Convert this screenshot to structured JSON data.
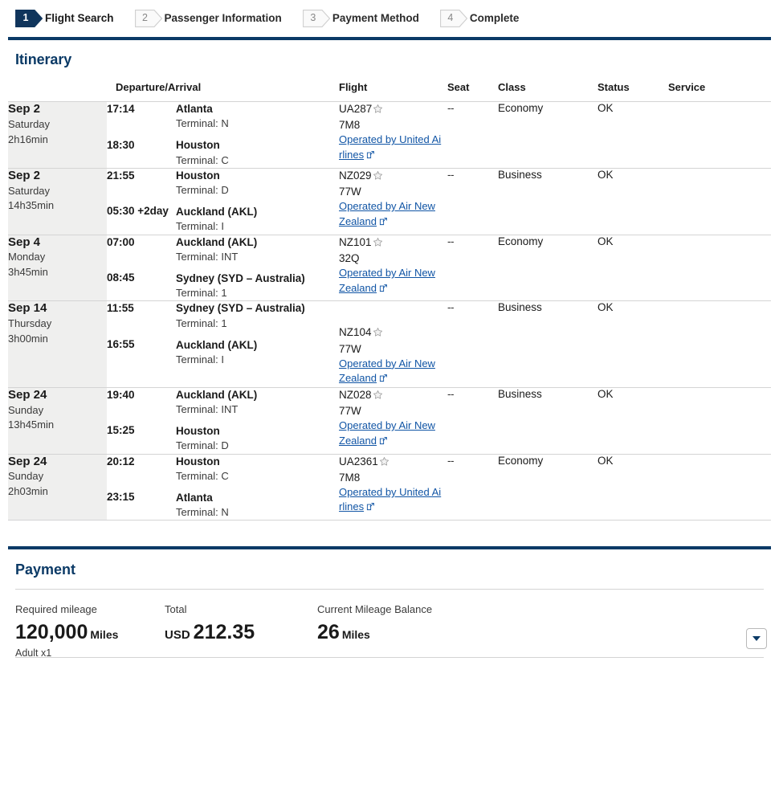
{
  "stepper": {
    "steps": [
      {
        "num": "1",
        "label": "Flight Search",
        "state": "active"
      },
      {
        "num": "2",
        "label": "Passenger Information",
        "state": "inactive"
      },
      {
        "num": "3",
        "label": "Payment Method",
        "state": "inactive"
      },
      {
        "num": "4",
        "label": "Complete",
        "state": "inactive"
      }
    ]
  },
  "itinerary": {
    "title": "Itinerary",
    "columns": {
      "date": "",
      "departure_arrival": "Departure/Arrival",
      "flight": "Flight",
      "seat": "Seat",
      "class": "Class",
      "status": "Status",
      "service": "Service"
    },
    "rows": [
      {
        "date": "Sep 2",
        "weekday": "Saturday",
        "duration": "2h16min",
        "dep_time": "17:14",
        "dep_place": "Atlanta",
        "dep_terminal": "Terminal: N",
        "arr_time": "18:30",
        "arr_dayoffset": "",
        "arr_place": "Houston",
        "arr_terminal": "Terminal: C",
        "flight_no": "UA287",
        "aircraft": "7M8",
        "operated_by": "Operated by United Airlines",
        "seat": "--",
        "class": "Economy",
        "status": "OK",
        "service": ""
      },
      {
        "date": "Sep 2",
        "weekday": "Saturday",
        "duration": "14h35min",
        "dep_time": "21:55",
        "dep_place": "Houston",
        "dep_terminal": "Terminal: D",
        "arr_time": "05:30",
        "arr_dayoffset": "+2day",
        "arr_place": "Auckland (AKL)",
        "arr_terminal": "Terminal: I",
        "flight_no": "NZ029",
        "aircraft": "77W",
        "operated_by": "Operated by Air New Zealand",
        "seat": "--",
        "class": "Business",
        "status": "OK",
        "service": ""
      },
      {
        "date": "Sep 4",
        "weekday": "Monday",
        "duration": "3h45min",
        "dep_time": "07:00",
        "dep_place": "Auckland (AKL)",
        "dep_terminal": "Terminal: INT",
        "arr_time": "08:45",
        "arr_dayoffset": "",
        "arr_place": "Sydney (SYD – Australia)",
        "arr_terminal": "Terminal: 1",
        "flight_no": "NZ101",
        "aircraft": "32Q",
        "operated_by": "Operated by Air New Zealand",
        "seat": "--",
        "class": "Economy",
        "status": "OK",
        "service": ""
      },
      {
        "date": "Sep 14",
        "weekday": "Thursday",
        "duration": "3h00min",
        "dep_time": "11:55",
        "dep_place": "Sydney (SYD – Australia)",
        "dep_terminal": "Terminal: 1",
        "arr_time": "16:55",
        "arr_dayoffset": "",
        "arr_place": "Auckland (AKL)",
        "arr_terminal": "Terminal: I",
        "flight_no": "NZ104",
        "aircraft": "77W",
        "operated_by": "Operated by Air New Zealand",
        "seat": "--",
        "class": "Business",
        "status": "OK",
        "service": ""
      },
      {
        "date": "Sep 24",
        "weekday": "Sunday",
        "duration": "13h45min",
        "dep_time": "19:40",
        "dep_place": "Auckland (AKL)",
        "dep_terminal": "Terminal: INT",
        "arr_time": "15:25",
        "arr_dayoffset": "",
        "arr_place": "Houston",
        "arr_terminal": "Terminal: D",
        "flight_no": "NZ028",
        "aircraft": "77W",
        "operated_by": "Operated by Air New Zealand",
        "seat": "--",
        "class": "Business",
        "status": "OK",
        "service": ""
      },
      {
        "date": "Sep 24",
        "weekday": "Sunday",
        "duration": "2h03min",
        "dep_time": "20:12",
        "dep_place": "Houston",
        "dep_terminal": "Terminal: C",
        "arr_time": "23:15",
        "arr_dayoffset": "",
        "arr_place": "Atlanta",
        "arr_terminal": "Terminal: N",
        "flight_no": "UA2361",
        "aircraft": "7M8",
        "operated_by": "Operated by United Airlines",
        "seat": "--",
        "class": "Economy",
        "status": "OK",
        "service": ""
      }
    ]
  },
  "payment": {
    "title": "Payment",
    "required_mileage_label": "Required mileage",
    "required_mileage_value": "120,000",
    "required_mileage_unit": "Miles",
    "required_mileage_sub": "Adult x1",
    "total_label": "Total",
    "total_currency": "USD",
    "total_value": "212.35",
    "balance_label": "Current Mileage Balance",
    "balance_value": "26",
    "balance_unit": "Miles"
  },
  "icons": {
    "star": "star-icon",
    "external_link": "external-link-icon",
    "chevron_down": "chevron-down-icon"
  },
  "colors": {
    "navy": "#0b3a66",
    "link": "#1155a5",
    "row_date_bg": "#efefee",
    "border": "#d4d4d4"
  }
}
